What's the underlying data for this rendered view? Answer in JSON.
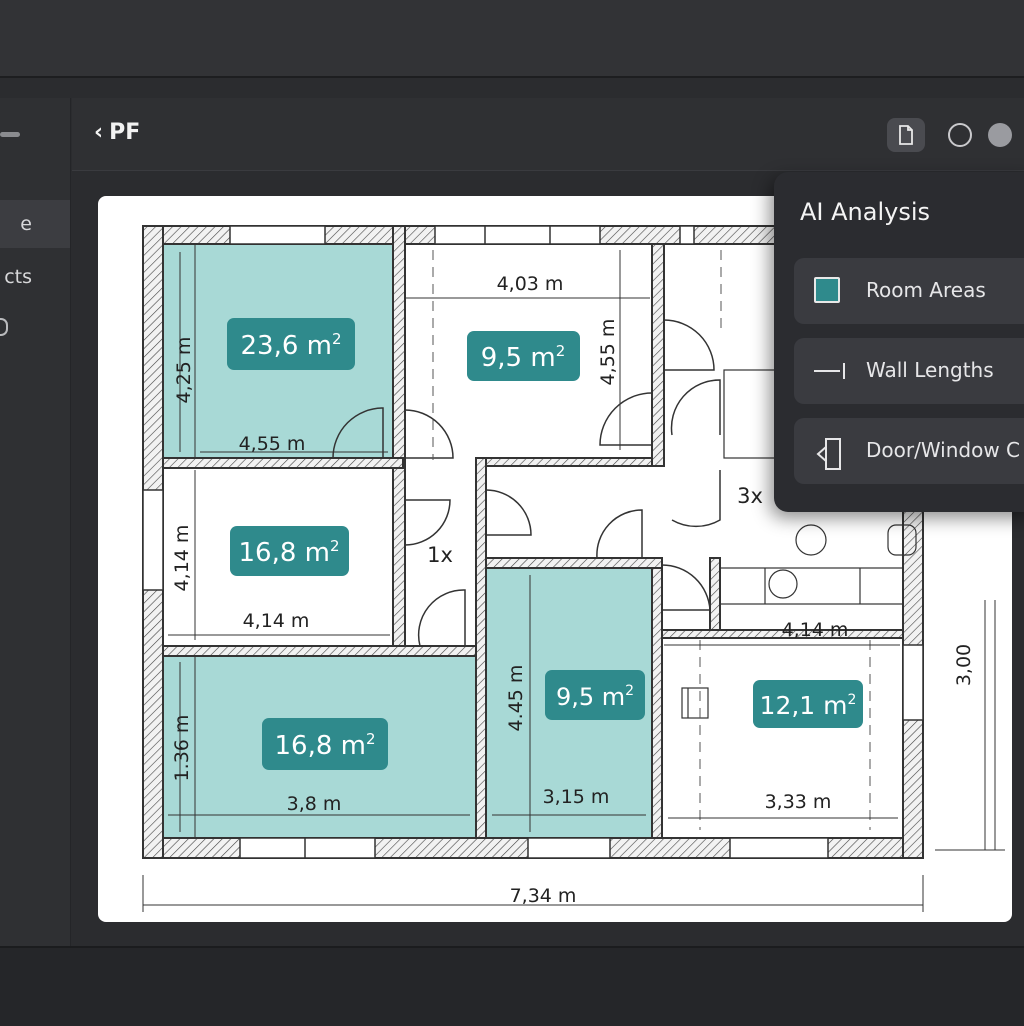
{
  "header": {
    "back_label": "PF"
  },
  "sidebar": {
    "items": [
      {
        "label": "e"
      },
      {
        "label": "cts"
      }
    ]
  },
  "panel": {
    "title": "AI Analysis",
    "items": [
      {
        "label": "Room Areas",
        "icon": "square-swatch-icon"
      },
      {
        "label": "Wall Lengths",
        "icon": "ruler-line-icon"
      },
      {
        "label": "Door/Window C",
        "icon": "door-icon"
      }
    ]
  },
  "floorplan": {
    "rooms": [
      {
        "area": "23,6",
        "width": "4,55 m",
        "height": "4,25 m"
      },
      {
        "area": "9,5",
        "width": "4,03 m",
        "height": "4,55 m"
      },
      {
        "area": "16,8",
        "width": "4,14 m",
        "height": "4,14 m"
      },
      {
        "area": "16,8",
        "width": "3,8 m",
        "height": "1.36 m"
      },
      {
        "area": "9,5",
        "width": "3,15 m",
        "height": "4.45 m"
      },
      {
        "area": "12,1",
        "width": "3,33 m",
        "height": ""
      }
    ],
    "area_unit": "m",
    "area_exp": "2",
    "extra_dims": {
      "kitchen_width": "4,14 m",
      "right_height": "3,00",
      "total_width": "7,34 m"
    },
    "counts": {
      "hall": "1x",
      "bath": "3x"
    },
    "colors": {
      "room_fill": "#a8d9d6",
      "label_bg": "#2f8a8c",
      "wall": "#333333"
    }
  }
}
